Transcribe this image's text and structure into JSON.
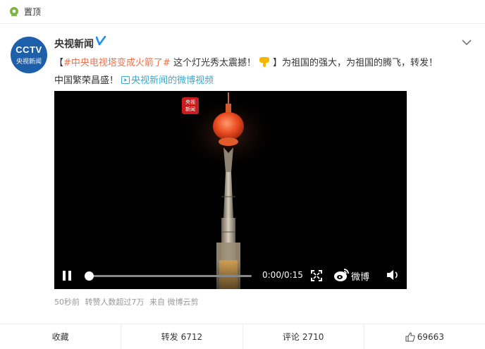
{
  "pinned": {
    "label": "置顶"
  },
  "author": {
    "name": "央视新闻",
    "avatar_logo": "CCTV",
    "avatar_sub": "央视新闻"
  },
  "post": {
    "line1": {
      "bracket_open": "【",
      "hashtag": "#中央电视塔变成火箭了#",
      "text": " 这个灯光秀太震撼！",
      "text2": "】为祖国的强大，为祖国的腾飞，转发！"
    },
    "line2": {
      "text": "中国繁荣昌盛！ ",
      "link": "央视新闻的微博视频"
    }
  },
  "video": {
    "watermark": "央视\n新闻",
    "time": "0:00/0:15",
    "progress": 0.02,
    "brand": "微博"
  },
  "meta": {
    "time": "50秒前",
    "reposts_note": "转赞人数超过7万",
    "source": "来自 微博云剪"
  },
  "actions": {
    "favorite": "收藏",
    "repost_label": "转发",
    "repost_count": "6712",
    "comment_label": "评论",
    "comment_count": "2710",
    "like_count": "69663"
  },
  "colors": {
    "accent_orange": "#eb7350",
    "link_blue": "#3ea7ce",
    "verified_blue": "#1a8ff2",
    "pin_green": "#7cb342"
  }
}
